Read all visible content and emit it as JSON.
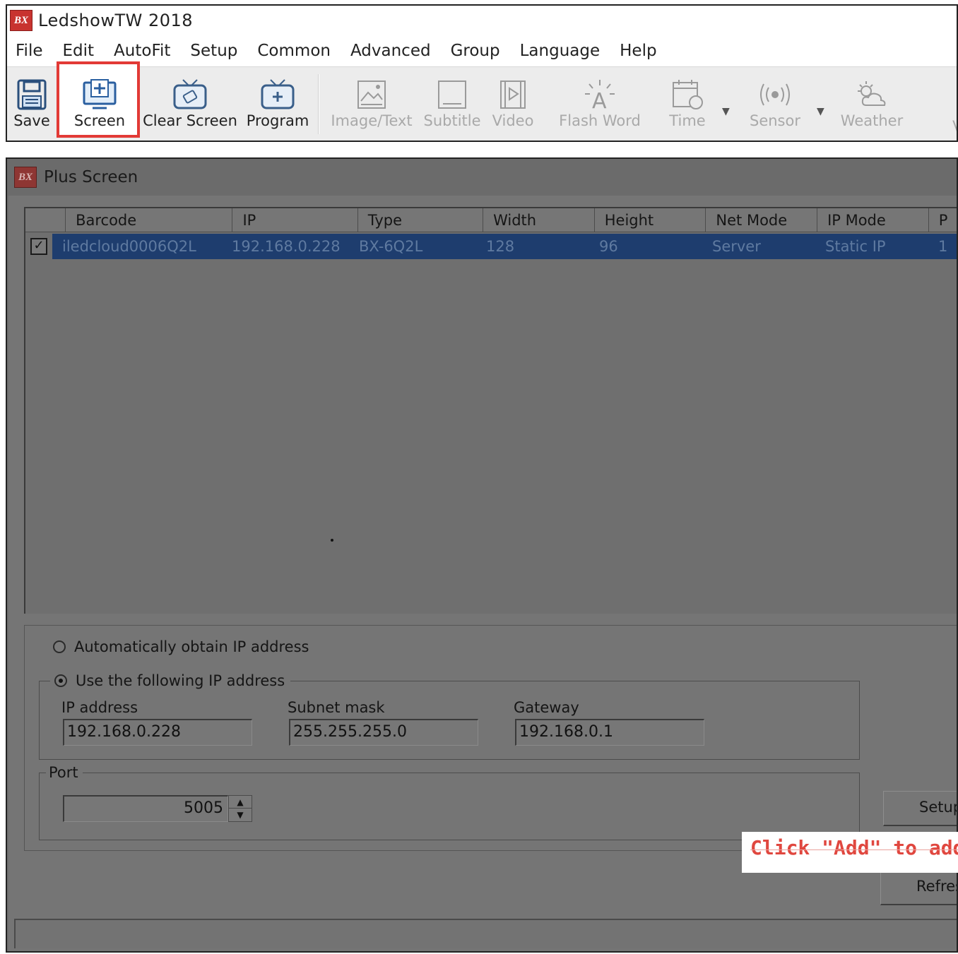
{
  "app": {
    "title": "LedshowTW 2018",
    "logo_text": "BX",
    "menu": [
      "File",
      "Edit",
      "AutoFit",
      "Setup",
      "Common",
      "Advanced",
      "Group",
      "Language",
      "Help"
    ],
    "toolbar": {
      "save": "Save",
      "screen": "Screen",
      "clear_screen": "Clear Screen",
      "program": "Program",
      "image_text": "Image/Text",
      "subtitle": "Subtitle",
      "video": "Video",
      "flash_word": "Flash Word",
      "time": "Time",
      "sensor": "Sensor",
      "weather": "Weather",
      "cut_off": "V"
    },
    "highlight_color": "#e23a36"
  },
  "dialog": {
    "title": "Plus Screen",
    "table": {
      "columns": [
        "Barcode",
        "IP",
        "Type",
        "Width",
        "Height",
        "Net Mode",
        "IP Mode",
        "P"
      ],
      "rows": [
        {
          "checked": true,
          "cells": [
            "iledcloud0006Q2L",
            "192.168.0.228",
            "BX-6Q2L",
            "128",
            "96",
            "Server",
            "Static IP",
            "1"
          ]
        }
      ]
    },
    "ip_settings": {
      "auto_label": "Automatically obtain IP address",
      "manual_label": "Use the following IP address",
      "selected": "manual",
      "ip_label": "IP address",
      "ip_value": "192.168.0.228",
      "mask_label": "Subnet mask",
      "mask_value": "255.255.255.0",
      "gateway_label": "Gateway",
      "gateway_value": "192.168.0.1",
      "port_label": "Port",
      "port_value": "5005"
    },
    "buttons": {
      "setup": "Setup",
      "refresh": "Refresh"
    },
    "annotation": "Click \"Add\" to add"
  }
}
